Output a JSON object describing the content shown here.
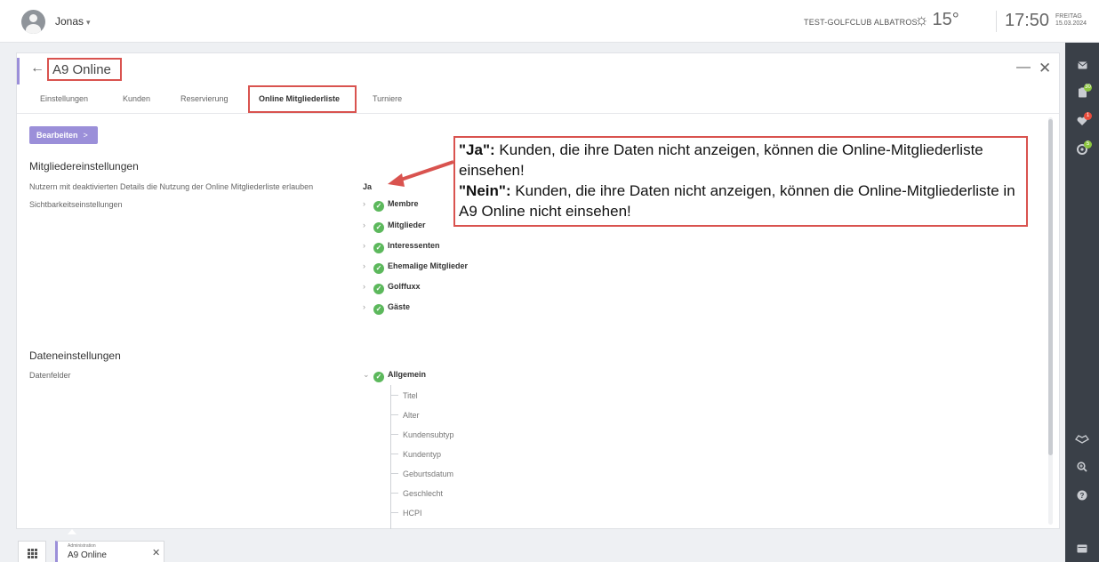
{
  "topbar": {
    "user_name": "Jonas",
    "user_caret": "▾",
    "club_name": "TEST-GOLFCLUB ALBATROS",
    "temperature": "15°",
    "time": "17:50",
    "weekday": "FREITAG",
    "date": "15.03.2024"
  },
  "window": {
    "back_symbol": "←",
    "title": "A9 Online",
    "minimize_symbol": "—",
    "close_symbol": "✕",
    "tabs": [
      {
        "label": "Einstellungen"
      },
      {
        "label": "Kunden"
      },
      {
        "label": "Reservierung"
      },
      {
        "label": "Online Mitgliederliste",
        "active": true
      },
      {
        "label": "Turniere"
      }
    ],
    "edit_button": "Bearbeiten",
    "edit_chevron": ">",
    "member_settings": {
      "heading": "Mitgliedereinstellungen",
      "fields": [
        {
          "label": "Nutzern mit deaktivierten Details die Nutzung der Online Mitgliederliste erlauben",
          "value": "Ja"
        },
        {
          "label": "Sichtbarkeitseinstellungen",
          "value": ""
        }
      ],
      "visibility_groups": [
        "Membre",
        "Mitglieder",
        "Interessenten",
        "Ehemalige Mitglieder",
        "Golffuxx",
        "Gäste"
      ]
    },
    "data_settings": {
      "heading": "Dateneinstellungen",
      "fields_label": "Datenfelder",
      "group": "Allgemein",
      "fields": [
        "Titel",
        "Alter",
        "Kundensubtyp",
        "Kundentyp",
        "Geburtsdatum",
        "Geschlecht",
        "HCPI"
      ]
    }
  },
  "callout": {
    "ja_key": "\"Ja\":",
    "ja_text": " Kunden, die ihre Daten nicht anzeigen, können die Online-Mitgliederliste einsehen!",
    "nein_key": "\"Nein\":",
    "nein_text": " Kunden, die ihre Daten nicht anzeigen, können die Online-Mitgliederliste in A9 Online nicht einsehen!"
  },
  "rightbar": {
    "badges": [
      "30",
      "1",
      "5"
    ]
  },
  "bottombar": {
    "task_category": "Administration",
    "task_name": "A9 Online",
    "task_close": "✕"
  },
  "colors": {
    "accent": "#9b8fd9",
    "annotation": "#d9534f",
    "check": "#5cb85c",
    "sidebar": "#3a4048"
  }
}
